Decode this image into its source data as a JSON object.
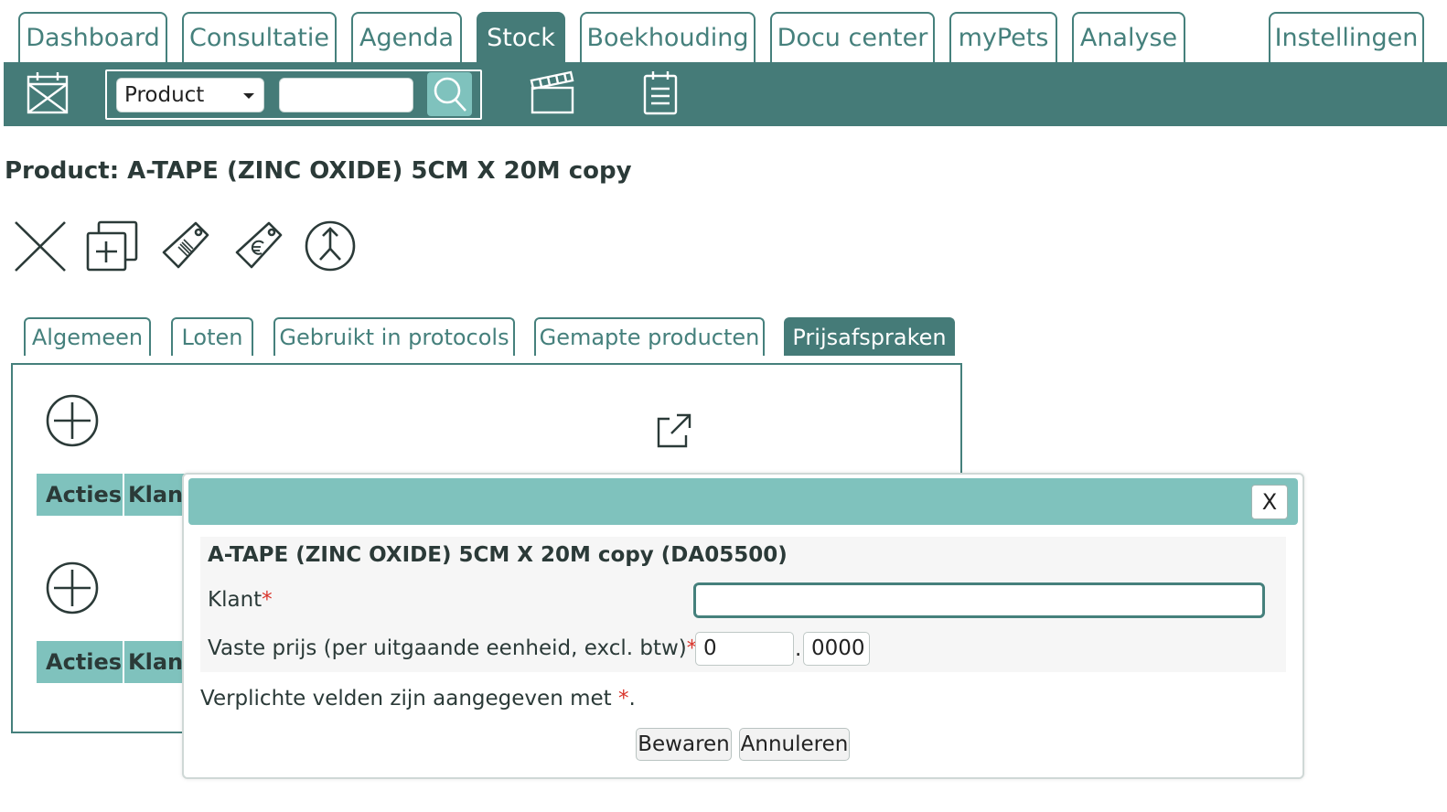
{
  "top_tabs": [
    {
      "label": "Dashboard"
    },
    {
      "label": "Consultatie"
    },
    {
      "label": "Agenda"
    },
    {
      "label": "Stock"
    },
    {
      "label": "Boekhouding"
    },
    {
      "label": "Docu center"
    },
    {
      "label": "myPets"
    },
    {
      "label": "Analyse"
    },
    {
      "label": "Instellingen"
    }
  ],
  "active_top_tab": "Stock",
  "toolbar": {
    "search_type": "Product",
    "search_value": "",
    "icons": [
      "calendar-x-icon",
      "search-icon",
      "clapperboard-icon",
      "clipboard-icon"
    ]
  },
  "page": {
    "title": "Product: A-TAPE (ZINC OXIDE) 5CM X 20M copy",
    "action_icons": [
      "delete-x-icon",
      "duplicate-icon",
      "barcode-tag-icon",
      "euro-tag-icon",
      "merge-icon"
    ]
  },
  "sub_tabs": [
    {
      "label": "Algemeen"
    },
    {
      "label": "Loten"
    },
    {
      "label": "Gebruikt in protocols"
    },
    {
      "label": "Gemapte producten"
    },
    {
      "label": "Prijsafspraken"
    }
  ],
  "active_sub_tab": "Prijsafspraken",
  "tables": [
    {
      "headers": [
        "Acties",
        "Klant"
      ]
    },
    {
      "headers": [
        "Acties",
        "Klant"
      ]
    }
  ],
  "modal": {
    "close_label": "X",
    "heading": "A-TAPE (ZINC OXIDE) 5CM X 20M copy (DA05500)",
    "klant_label": "Klant",
    "klant_value": "",
    "price_label": "Vaste prijs (per uitgaande eenheid, excl. btw)",
    "price_int": "0",
    "price_dec": "0000",
    "required_mark": "*",
    "note_prefix": "Verplichte velden zijn aangegeven met ",
    "note_mark": "*",
    "note_suffix": ".",
    "save_label": "Bewaren",
    "cancel_label": "Annuleren"
  },
  "colors": {
    "primary": "#457b78",
    "accent": "#7fc2bd",
    "required": "#d9342b"
  }
}
